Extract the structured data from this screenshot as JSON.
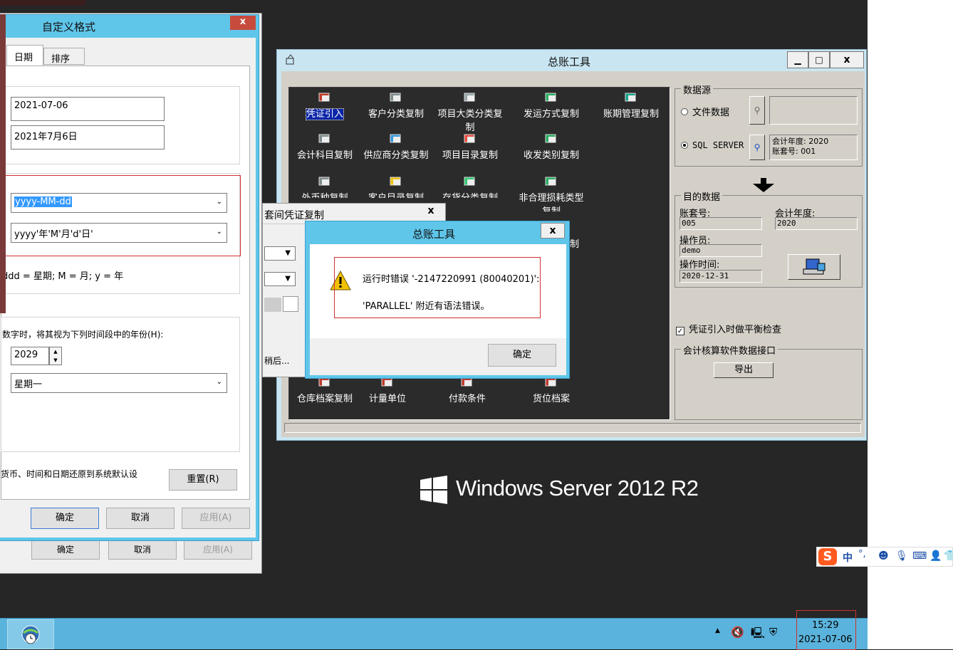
{
  "custom_format": {
    "title": "自定义格式",
    "close": "x",
    "tabs": [
      "日期",
      "排序"
    ],
    "date_short_example": "2021-07-06",
    "date_long_example": "2021年7月6日",
    "short_format_value": "yyyy-MM-dd",
    "long_format_value": "yyyy'年'M'月'd'日'",
    "legend": "ddd = 星期;  M = 月;  y = 年",
    "year_rule_label": "数字时，将其视为下列时间段中的年份(H):",
    "year_value": "2029",
    "first_day_value": "星期一",
    "reset_desc": "货币、时间和日期还原到系统默认设",
    "reset_button": "重置(R)",
    "ok": "确定",
    "cancel": "取消",
    "apply": "应用(A)"
  },
  "parent_buttons": {
    "ok": "确定",
    "cancel": "取消",
    "apply": "应用(A)"
  },
  "gl_tool": {
    "title": "总账工具",
    "min": "▁",
    "max": "□",
    "close": "x",
    "icons": [
      {
        "label": "凭证引入",
        "selected": true
      },
      {
        "label": "客户分类复制"
      },
      {
        "label": "项目大类分类复制"
      },
      {
        "label": "发运方式复制"
      },
      {
        "label": "账期管理复制"
      },
      {
        "label": "会计科目复制"
      },
      {
        "label": "供应商分类复制"
      },
      {
        "label": "项目目录复制"
      },
      {
        "label": "收发类别复制"
      },
      {
        "label": "外币种复制"
      },
      {
        "label": "客户目录复制"
      },
      {
        "label": "存货分类复制"
      },
      {
        "label": "非合理损耗类型复制"
      },
      {
        "label": "仓库档案复制"
      },
      {
        "label": "计量单位"
      },
      {
        "label": "付款条件"
      },
      {
        "label": "货位档案"
      }
    ],
    "source": {
      "group_title": "数据源",
      "file_option": "文件数据",
      "sql_option": "SQL SERVER",
      "sql_info_year": "会计年度: 2020",
      "sql_info_acct": "账套号: 001"
    },
    "target": {
      "group_title": "目的数据",
      "acct_label": "账套号:",
      "acct_value": "005",
      "year_label": "会计年度:",
      "year_value": "2020",
      "operator_label": "操作员:",
      "operator_value": "demo",
      "time_label": "操作时间:",
      "time_value": "2020-12-31"
    },
    "balance_check": "凭证引入时做平衡检查",
    "interface_group": "会计核算软件数据接口",
    "export_button": "导出"
  },
  "voucher_copy": {
    "title": "套间凭证复制",
    "close": "x",
    "later": "稍后..."
  },
  "side_fragments": [
    "制",
    "刂",
    "刂"
  ],
  "error_dialog": {
    "title": "总账工具",
    "close": "x",
    "line1": "运行时错误 '-2147220991 (80040201)':",
    "line2": "'PARALLEL' 附近有语法错误。",
    "ok": "确定"
  },
  "brand": "Windows Server 2012 R2",
  "ime": {
    "label": "中",
    "extra": "°,"
  },
  "taskbar": {
    "time": "15:29",
    "date": "2021-07-06",
    "tray_arrow": "▲"
  },
  "colors": {
    "accent": "#5fc6ea",
    "error_highlight": "#d0312d"
  }
}
